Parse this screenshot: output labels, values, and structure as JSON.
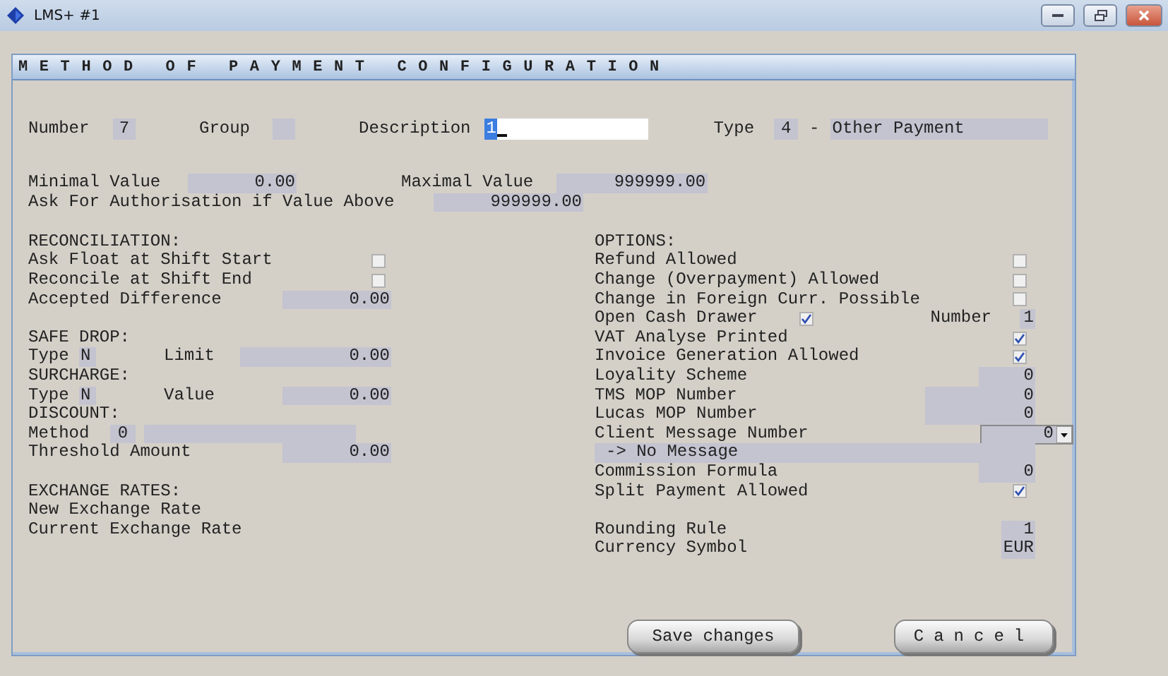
{
  "window": {
    "title": "LMS+ #1"
  },
  "form": {
    "title": "METHOD OF PAYMENT CONFIGURATION"
  },
  "header": {
    "number_label": "Number",
    "number": "7",
    "group_label": "Group",
    "description_label": "Description",
    "description": "1",
    "type_label": "Type",
    "type_code": "4",
    "type_separator": "-",
    "type_name": "Other Payment"
  },
  "limits": {
    "minimal_label": "Minimal Value",
    "minimal": "0.00",
    "maximal_label": "Maximal Value",
    "maximal": "999999.00",
    "authorisation_label": "Ask For Authorisation if Value Above",
    "authorisation": "999999.00"
  },
  "left_rows": [
    {
      "kind": "heading",
      "label": "RECONCILIATION:"
    },
    {
      "kind": "check",
      "label": "Ask Float at Shift Start",
      "checked": false
    },
    {
      "kind": "check",
      "label": "Reconcile at Shift End",
      "checked": false
    },
    {
      "kind": "amount",
      "label": "Accepted Difference",
      "value": "0.00"
    },
    {
      "kind": "blank"
    },
    {
      "kind": "heading",
      "label": "SAFE DROP:"
    },
    {
      "kind": "typed",
      "label": "Type",
      "type": "N",
      "label2": "Limit",
      "value": "0.00"
    },
    {
      "kind": "heading",
      "label": "SURCHARGE:"
    },
    {
      "kind": "typed",
      "label": "Type",
      "type": "N",
      "label2": "Value",
      "value": "0.00"
    },
    {
      "kind": "heading",
      "label": "DISCOUNT:"
    },
    {
      "kind": "method",
      "label": "Method",
      "code": "0"
    },
    {
      "kind": "amount",
      "label": "Threshold Amount",
      "value": "0.00"
    },
    {
      "kind": "blank"
    },
    {
      "kind": "heading",
      "label": "EXCHANGE RATES:"
    },
    {
      "kind": "heading",
      "label": "New Exchange Rate"
    },
    {
      "kind": "heading",
      "label": "Current Exchange Rate"
    }
  ],
  "right_rows": [
    {
      "kind": "heading",
      "label": "OPTIONS:"
    },
    {
      "kind": "check",
      "label": "Refund Allowed",
      "checked": false
    },
    {
      "kind": "check",
      "label": "Change (Overpayment) Allowed",
      "checked": false
    },
    {
      "kind": "check",
      "label": "Change in Foreign Curr. Possible",
      "checked": false
    },
    {
      "kind": "drawer",
      "label": "Open Cash Drawer",
      "checked": true,
      "label2": "Number",
      "value": "1"
    },
    {
      "kind": "check",
      "label": "VAT Analyse Printed",
      "checked": true
    },
    {
      "kind": "check",
      "label": "Invoice Generation Allowed",
      "checked": true
    },
    {
      "kind": "value",
      "label": "Loyality Scheme",
      "value": "0"
    },
    {
      "kind": "wide_value",
      "label": "TMS MOP Number",
      "value": "0"
    },
    {
      "kind": "wide_value",
      "label": "Lucas MOP Number",
      "value": "0"
    },
    {
      "kind": "dropdown",
      "label": "Client Message Number",
      "value": "0"
    },
    {
      "kind": "message",
      "label": "-> No Message"
    },
    {
      "kind": "value",
      "label": "Commission Formula",
      "value": "0"
    },
    {
      "kind": "check",
      "label": "Split Payment Allowed",
      "checked": true
    },
    {
      "kind": "blank"
    },
    {
      "kind": "small_value",
      "label": "Rounding Rule",
      "value": "1"
    },
    {
      "kind": "small_value",
      "label": "Currency Symbol",
      "value": "EUR"
    }
  ],
  "buttons": [
    {
      "label": "Save changes"
    },
    {
      "label": "Cancel"
    }
  ]
}
